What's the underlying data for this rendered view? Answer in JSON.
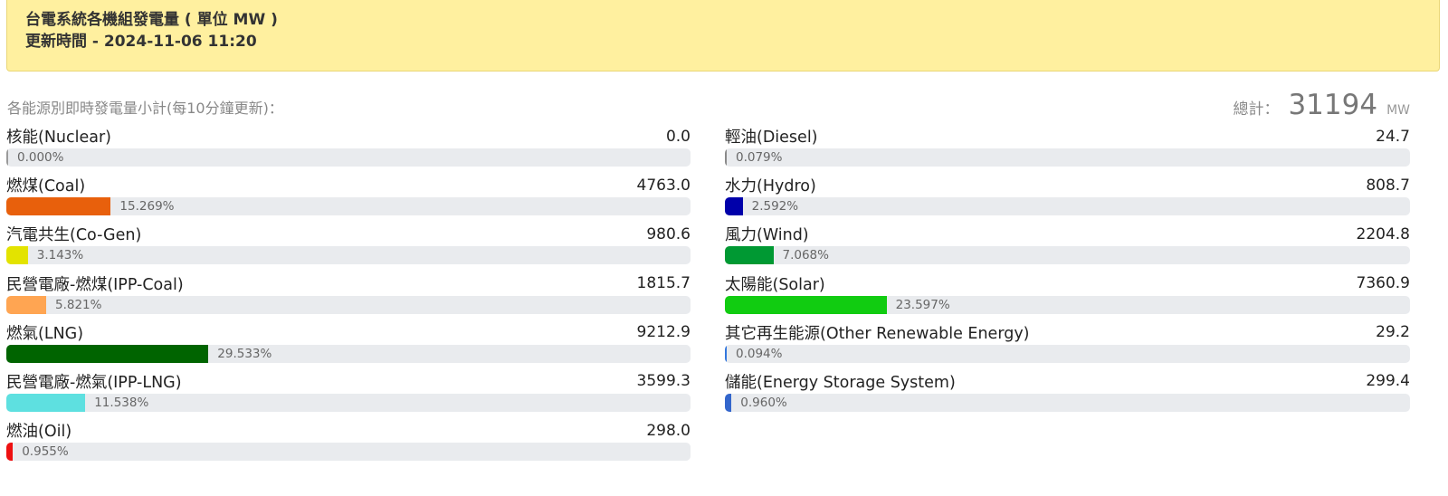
{
  "header": {
    "title": "台電系統各機組發電量 ( 單位 MW )",
    "updated": "更新時間 - 2024-11-06 11:20"
  },
  "summary": {
    "subtitle": "各能源別即時發電量小計(每10分鐘更新)：",
    "total_label": "總計：",
    "total_value": "31194",
    "total_unit": "MW"
  },
  "left_items": [
    {
      "name": "核能(Nuclear)",
      "value": "0.0",
      "percent": 0.0,
      "percent_label": "0.000%",
      "color": "#9a9a9a"
    },
    {
      "name": "燃煤(Coal)",
      "value": "4763.0",
      "percent": 15.269,
      "percent_label": "15.269%",
      "color": "#e8600c"
    },
    {
      "name": "汽電共生(Co-Gen)",
      "value": "980.6",
      "percent": 3.143,
      "percent_label": "3.143%",
      "color": "#e3e300"
    },
    {
      "name": "民營電廠-燃煤(IPP-Coal)",
      "value": "1815.7",
      "percent": 5.821,
      "percent_label": "5.821%",
      "color": "#ffa552"
    },
    {
      "name": "燃氣(LNG)",
      "value": "9212.9",
      "percent": 29.533,
      "percent_label": "29.533%",
      "color": "#006400"
    },
    {
      "name": "民營電廠-燃氣(IPP-LNG)",
      "value": "3599.3",
      "percent": 11.538,
      "percent_label": "11.538%",
      "color": "#5ee0e0"
    },
    {
      "name": "燃油(Oil)",
      "value": "298.0",
      "percent": 0.955,
      "percent_label": "0.955%",
      "color": "#ee1111"
    }
  ],
  "right_items": [
    {
      "name": "輕油(Diesel)",
      "value": "24.7",
      "percent": 0.079,
      "percent_label": "0.079%",
      "color": "#8a8a8a"
    },
    {
      "name": "水力(Hydro)",
      "value": "808.7",
      "percent": 2.592,
      "percent_label": "2.592%",
      "color": "#0000aa"
    },
    {
      "name": "風力(Wind)",
      "value": "2204.8",
      "percent": 7.068,
      "percent_label": "7.068%",
      "color": "#009933"
    },
    {
      "name": "太陽能(Solar)",
      "value": "7360.9",
      "percent": 23.597,
      "percent_label": "23.597%",
      "color": "#11cc11"
    },
    {
      "name": "其它再生能源(Other Renewable Energy)",
      "value": "29.2",
      "percent": 0.094,
      "percent_label": "0.094%",
      "color": "#3377dd"
    },
    {
      "name": "儲能(Energy Storage System)",
      "value": "299.4",
      "percent": 0.96,
      "percent_label": "0.960%",
      "color": "#3366cc"
    }
  ]
}
